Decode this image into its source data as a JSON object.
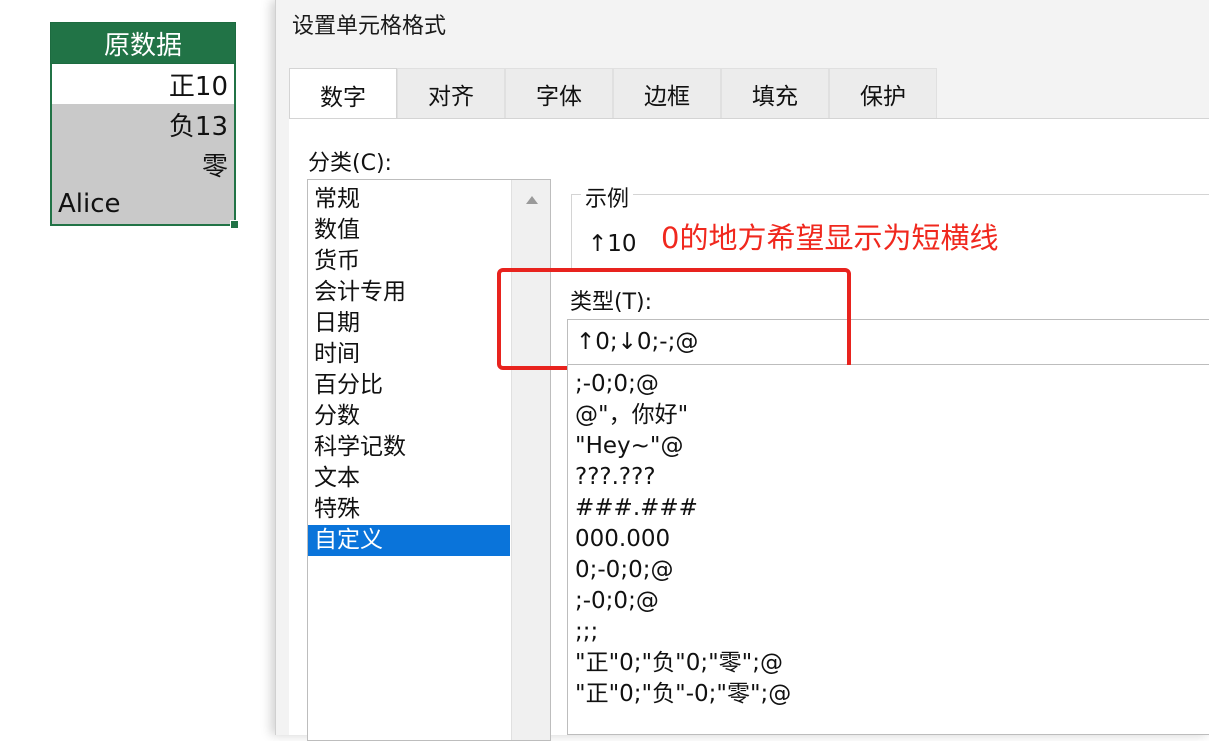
{
  "sheet": {
    "header": "原数据",
    "rows": [
      "正10",
      "负13",
      "零",
      "Alice"
    ]
  },
  "dialog": {
    "title": "设置单元格格式",
    "tabs": [
      "数字",
      "对齐",
      "字体",
      "边框",
      "填充",
      "保护"
    ],
    "category_label": "分类(C):",
    "categories": [
      "常规",
      "数值",
      "货币",
      "会计专用",
      "日期",
      "时间",
      "百分比",
      "分数",
      "科学记数",
      "文本",
      "特殊",
      "自定义"
    ],
    "selected_category": "自定义",
    "sample_title": "示例",
    "sample_value": "↑10",
    "annotation": "0的地方希望显示为短横线",
    "type_label": "类型(T):",
    "type_value": "↑0;↓0;-;@",
    "format_list": [
      ";-0;0;@",
      "@\"，你好\"",
      "\"Hey~\"@",
      "???.???",
      "###.###",
      "000.000",
      "0;-0;0;@",
      ";-0;0;@",
      ";;;",
      "\"正\"0;\"负\"0;\"零\";@",
      "\"正\"0;\"负\"-0;\"零\";@"
    ]
  }
}
